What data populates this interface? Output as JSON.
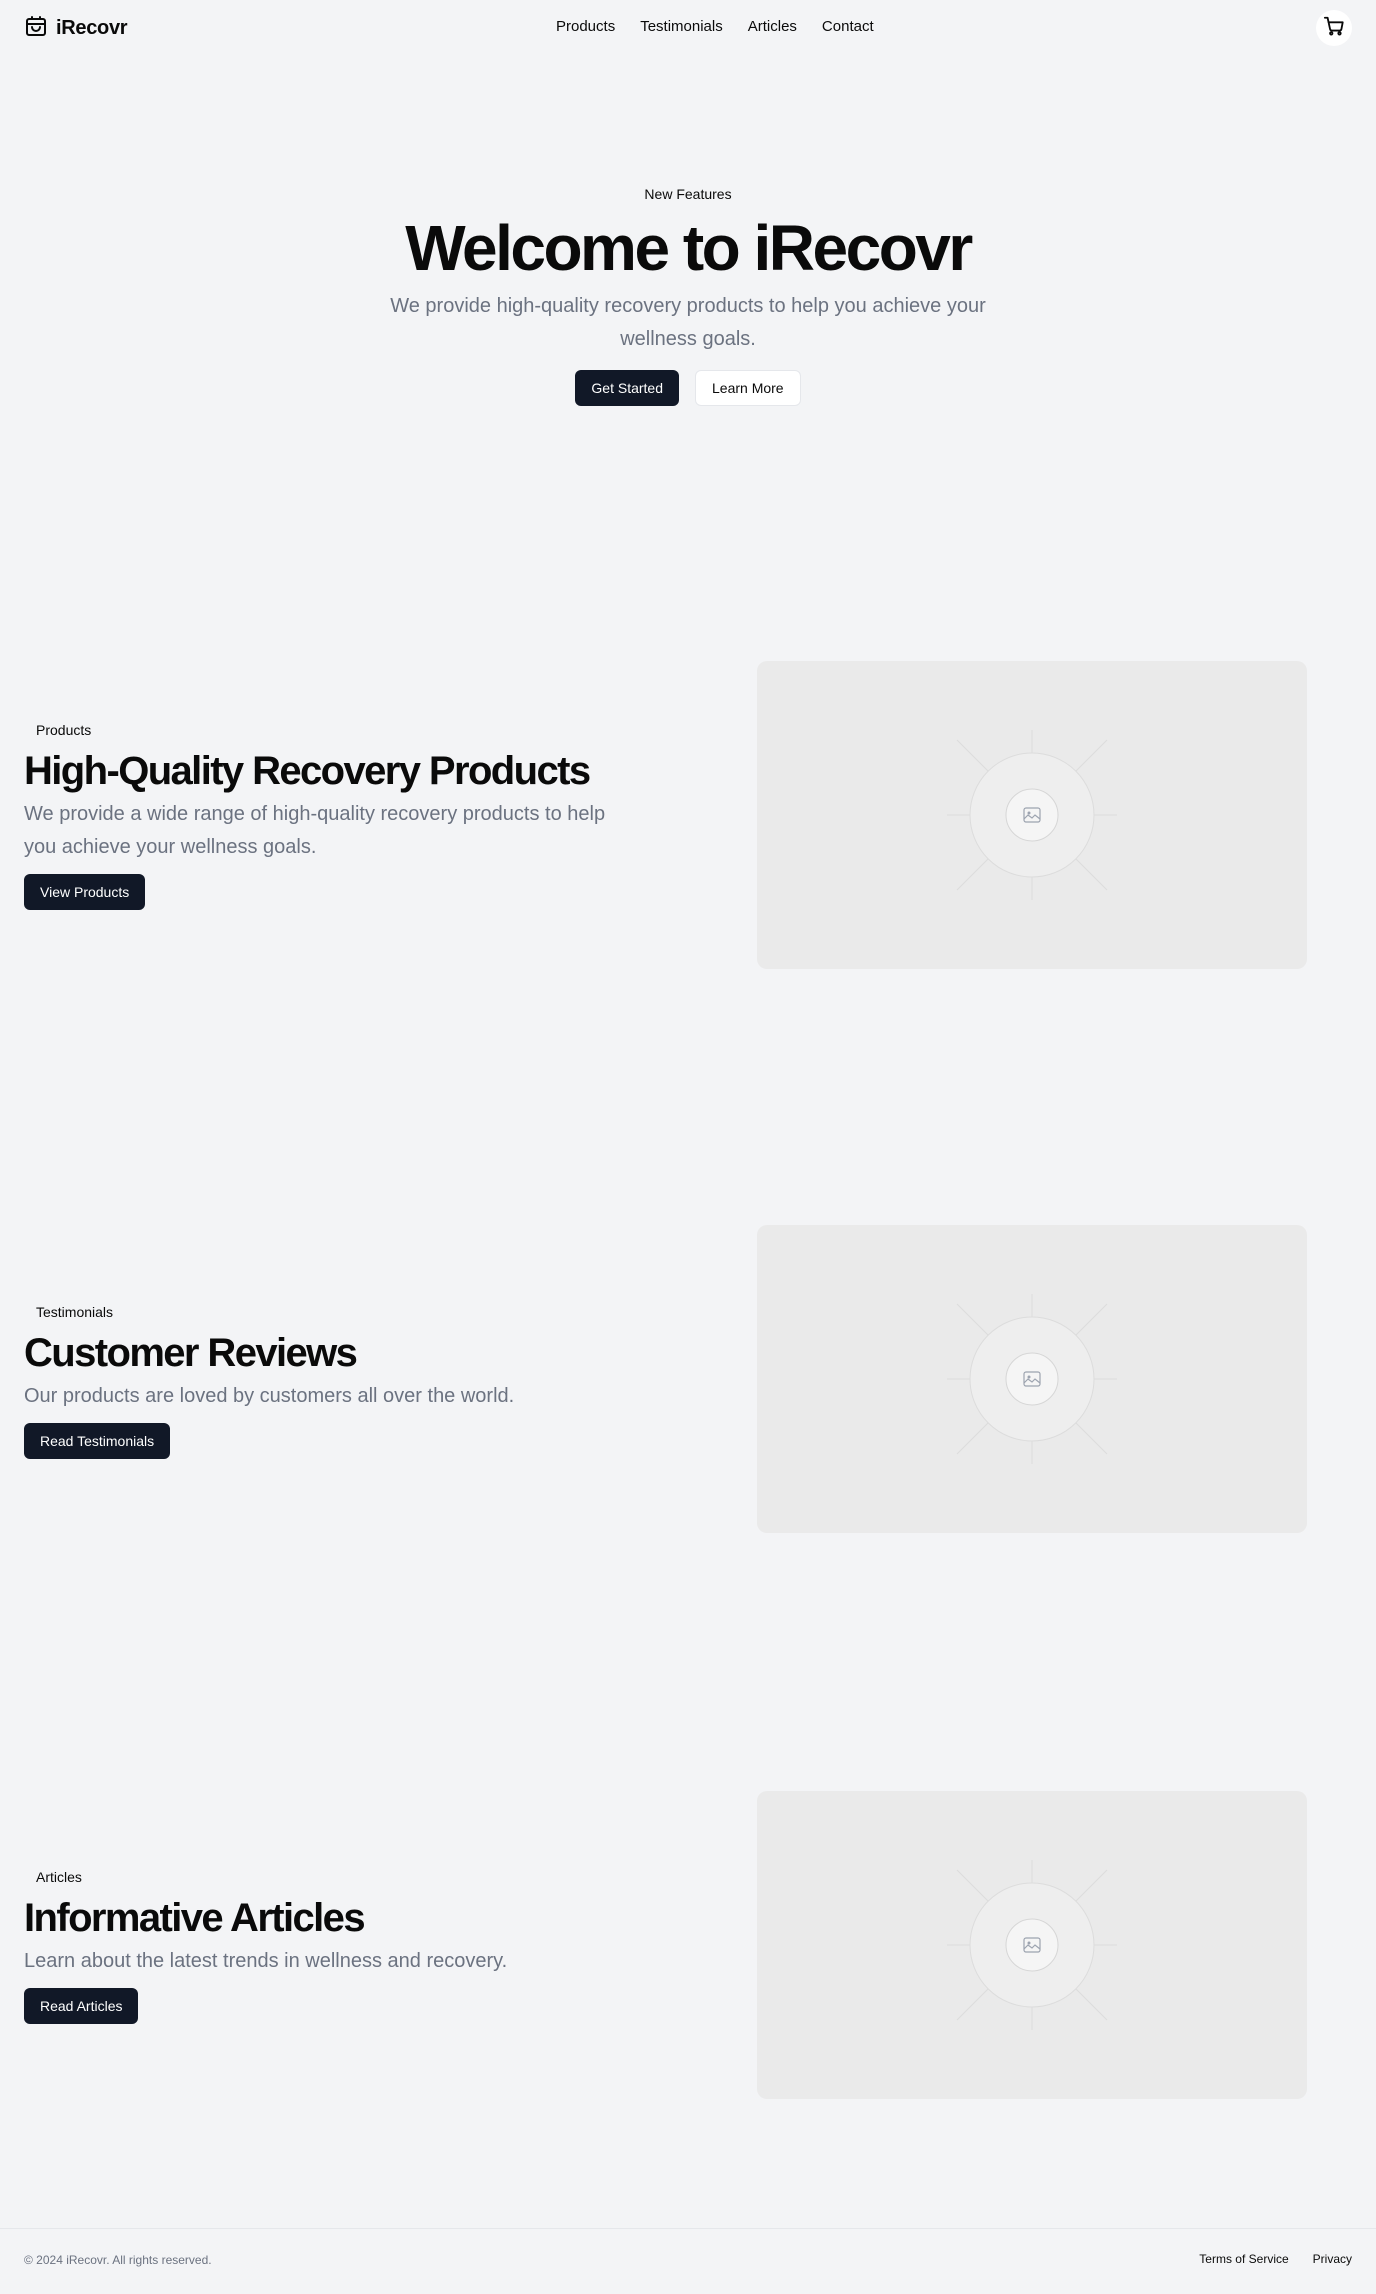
{
  "header": {
    "brand": "iRecovr",
    "nav": [
      "Products",
      "Testimonials",
      "Articles",
      "Contact"
    ],
    "cart_icon": "shopping-cart-icon",
    "brand_icon": "package-icon"
  },
  "hero": {
    "eyebrow": "New Features",
    "title": "Welcome to iRecovr",
    "subtitle": "We provide high-quality recovery products to help you achieve your wellness goals.",
    "primary_cta": "Get Started",
    "secondary_cta": "Learn More"
  },
  "features": [
    {
      "badge": "Products",
      "title": "High-Quality Recovery Products",
      "description": "We provide a wide range of high-quality recovery products to help you achieve your wellness goals.",
      "cta": "View Products"
    },
    {
      "badge": "Testimonials",
      "title": "Customer Reviews",
      "description": "Our products are loved by customers all over the world.",
      "cta": "Read Testimonials"
    },
    {
      "badge": "Articles",
      "title": "Informative Articles",
      "description": "Learn about the latest trends in wellness and recovery.",
      "cta": "Read Articles"
    }
  ],
  "footer": {
    "copyright": "© 2024 iRecovr. All rights reserved.",
    "links": [
      "Terms of Service",
      "Privacy"
    ]
  },
  "colors": {
    "background": "#f3f4f6",
    "primary_button": "#111827",
    "muted_text": "#6b7280",
    "placeholder": "#eaeaea"
  }
}
